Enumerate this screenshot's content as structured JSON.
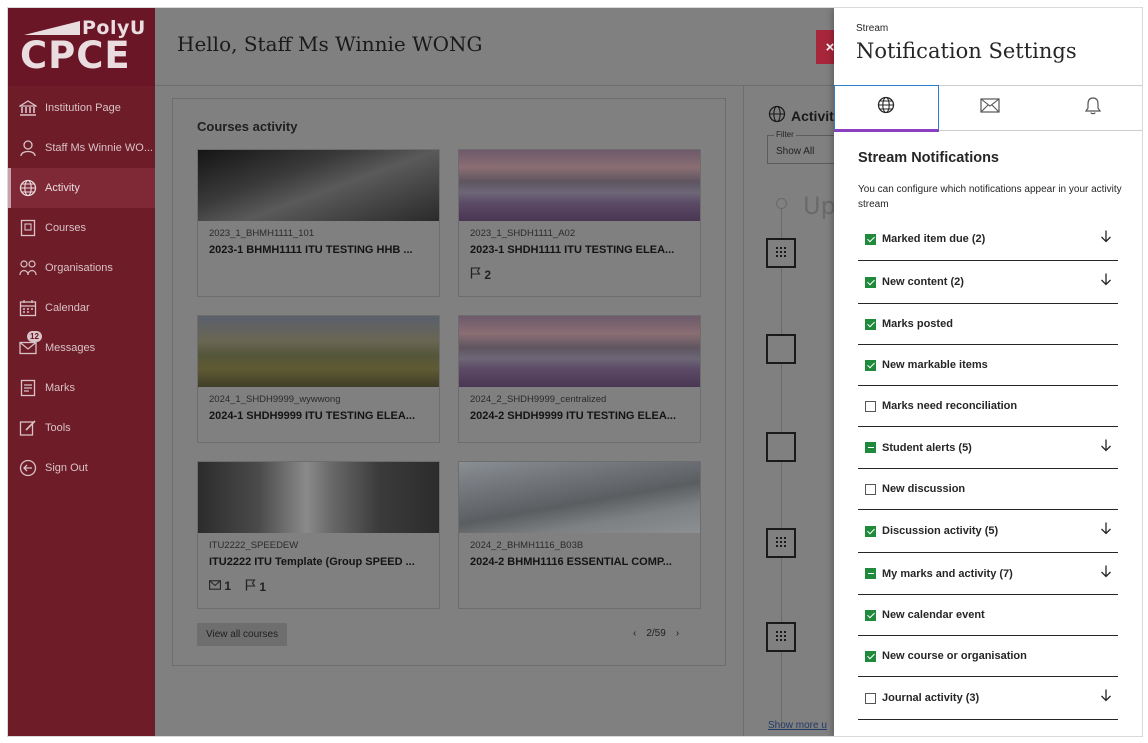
{
  "brand": {
    "top": "PolyU",
    "bottom": "CPCE"
  },
  "nav": [
    {
      "label": "Institution Page",
      "icon": "institution-icon"
    },
    {
      "label": "Staff Ms Winnie WO...",
      "icon": "user-icon"
    },
    {
      "label": "Activity",
      "icon": "globe-icon",
      "active": true
    },
    {
      "label": "Courses",
      "icon": "courses-icon"
    },
    {
      "label": "Organisations",
      "icon": "organisations-icon"
    },
    {
      "label": "Calendar",
      "icon": "calendar-icon"
    },
    {
      "label": "Messages",
      "icon": "envelope-icon",
      "badge": "12"
    },
    {
      "label": "Marks",
      "icon": "marks-icon"
    },
    {
      "label": "Tools",
      "icon": "tools-icon"
    },
    {
      "label": "Sign Out",
      "icon": "sign-out-icon"
    }
  ],
  "header": {
    "greeting": "Hello, Staff Ms Winnie WONG"
  },
  "courses": {
    "heading": "Courses activity",
    "cards": [
      {
        "code": "2023_1_BHMH1111_101",
        "title": "2023-1 BHMH1111 ITU TESTING HHB ...",
        "meta": []
      },
      {
        "code": "2023_1_SHDH1111_A02",
        "title": "2023-1 SHDH1111 ITU TESTING ELEA...",
        "meta": [
          {
            "icon": "flag-icon",
            "count": "2"
          }
        ]
      },
      {
        "code": "2024_1_SHDH9999_wywwong",
        "title": "2024-1 SHDH9999 ITU TESTING ELEA...",
        "meta": []
      },
      {
        "code": "2024_2_SHDH9999_centralized",
        "title": "2024-2 SHDH9999 ITU TESTING ELEA...",
        "meta": []
      },
      {
        "code": "ITU2222_SPEEDEW",
        "title": "ITU2222 ITU Template (Group SPEED ...",
        "meta": [
          {
            "icon": "envelope-icon",
            "count": "1"
          },
          {
            "icon": "flag-icon",
            "count": "1"
          }
        ]
      },
      {
        "code": "2024_2_BHMH1116_B03B",
        "title": "2024-2 BHMH1116 ESSENTIAL COMP...",
        "meta": []
      }
    ],
    "view_all": "View all courses",
    "pager": "2/59"
  },
  "activity": {
    "heading": "Activit",
    "filter_label": "Filter",
    "filter_value": "Show All",
    "upcoming": "Up",
    "show_more": "Show more u"
  },
  "panel": {
    "eyebrow": "Stream",
    "title": "Notification Settings",
    "tabs": [
      {
        "icon": "globe-icon",
        "active": true
      },
      {
        "icon": "envelope-icon",
        "active": false
      },
      {
        "icon": "bell-icon",
        "active": false
      }
    ],
    "section_title": "Stream Notifications",
    "section_desc": "You can configure which notifications appear in your activity stream",
    "items": [
      {
        "label": "Marked item due (2)",
        "state": "checked",
        "expand": true
      },
      {
        "label": "New content (2)",
        "state": "checked",
        "expand": true
      },
      {
        "label": "Marks posted",
        "state": "checked",
        "expand": false
      },
      {
        "label": "New markable items",
        "state": "checked",
        "expand": false
      },
      {
        "label": "Marks need reconciliation",
        "state": "unchecked",
        "expand": false
      },
      {
        "label": "Student alerts (5)",
        "state": "partial",
        "expand": true
      },
      {
        "label": "New discussion",
        "state": "unchecked",
        "expand": false
      },
      {
        "label": "Discussion activity (5)",
        "state": "checked",
        "expand": true
      },
      {
        "label": "My marks and activity (7)",
        "state": "partial",
        "expand": true
      },
      {
        "label": "New calendar event",
        "state": "checked",
        "expand": false
      },
      {
        "label": "New course or organisation",
        "state": "checked",
        "expand": false
      },
      {
        "label": "Journal activity (3)",
        "state": "unchecked",
        "expand": true
      }
    ]
  },
  "close_label": "×"
}
